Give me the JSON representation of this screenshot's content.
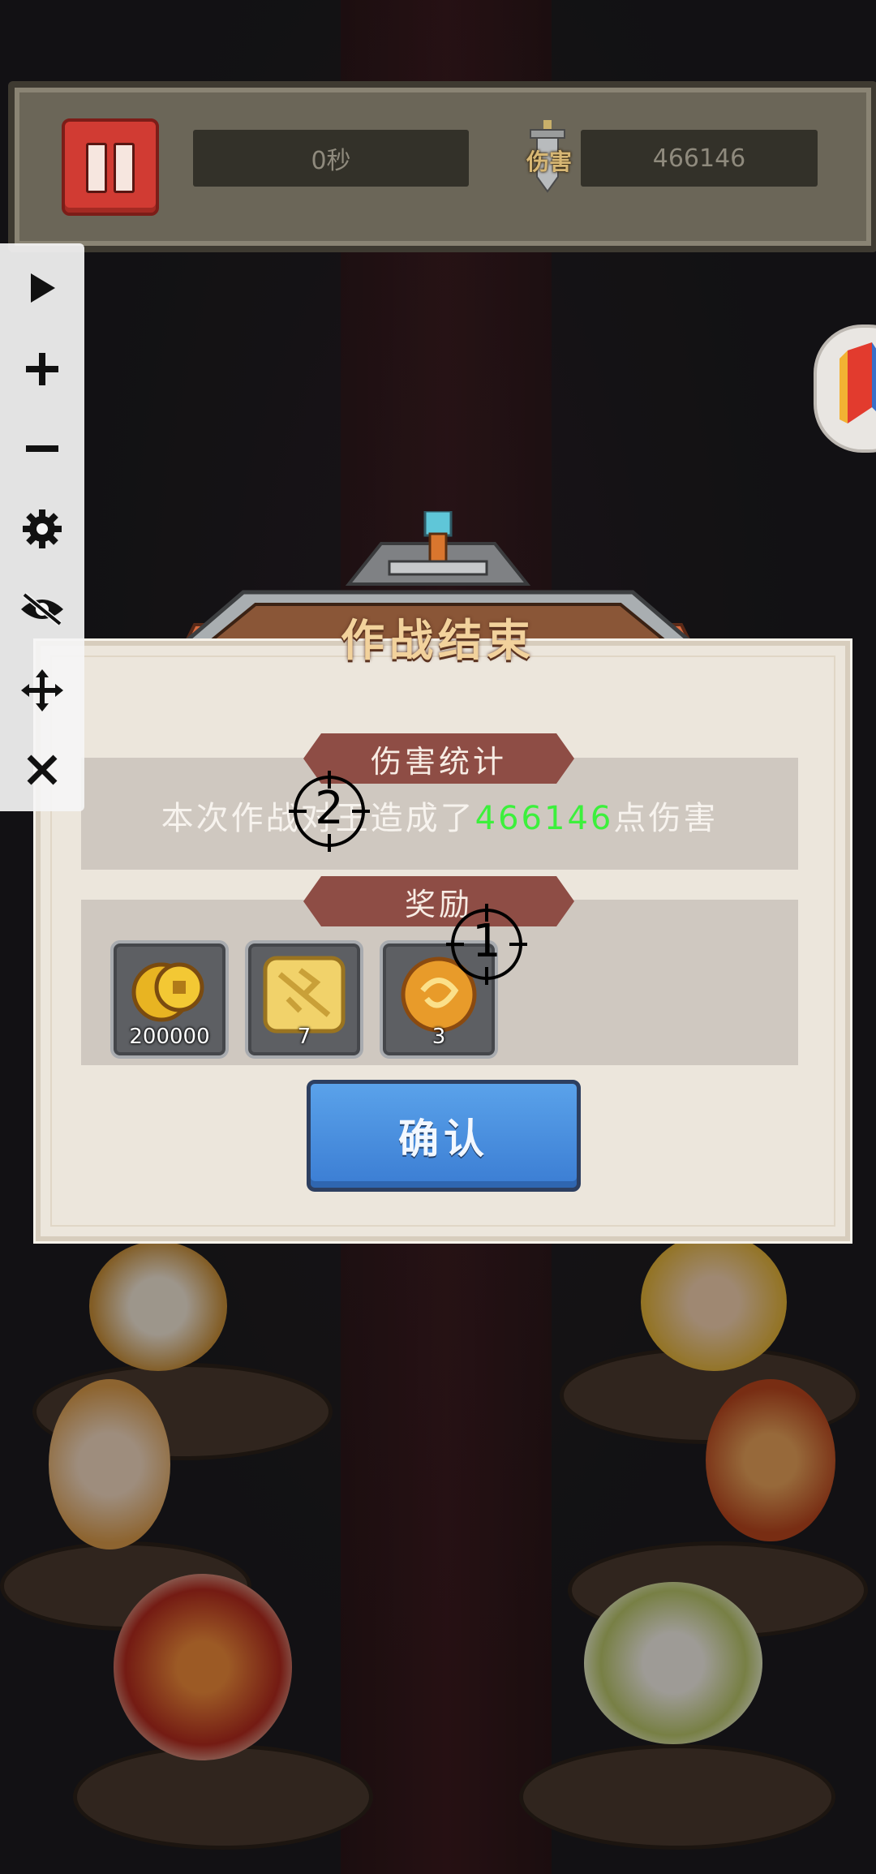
{
  "hud": {
    "timer": "0秒",
    "damage_label": "伤害",
    "damage_value": "466146"
  },
  "toolbar": {
    "items": [
      "play-icon",
      "zoom-in-icon",
      "zoom-out-icon",
      "settings-icon",
      "hide-icon",
      "move-icon",
      "close-icon"
    ]
  },
  "dialog": {
    "title": "作战结束",
    "stats_header": "伤害统计",
    "stats_prefix": "本次作战对",
    "stats_mid": "王造成了",
    "stats_value": "466146",
    "stats_suffix": "点伤害",
    "rewards_header": "奖励",
    "rewards": [
      {
        "icon": "gold-coin-icon",
        "qty": "200000"
      },
      {
        "icon": "rune-scroll-icon",
        "qty": "7"
      },
      {
        "icon": "golden-orb-icon",
        "qty": "3"
      }
    ],
    "confirm_label": "确认"
  },
  "markers": [
    {
      "label": "1"
    },
    {
      "label": "2"
    }
  ],
  "colors": {
    "accent_green": "#3cf03c",
    "confirm_blue": "#3b7dd3",
    "ribbon_brown": "#8e4d45",
    "pause_red": "#d13b33"
  }
}
